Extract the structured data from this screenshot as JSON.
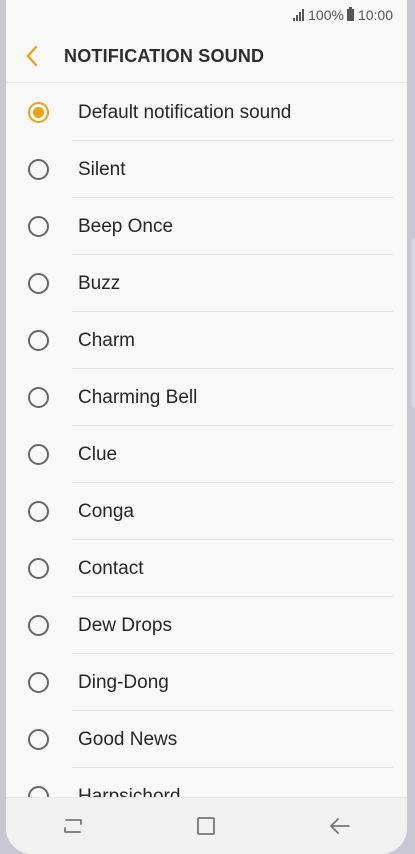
{
  "status_bar": {
    "battery": "100%",
    "time": "10:00"
  },
  "header": {
    "title": "NOTIFICATION SOUND"
  },
  "sounds": [
    {
      "label": "Default notification sound",
      "selected": true
    },
    {
      "label": "Silent",
      "selected": false
    },
    {
      "label": "Beep Once",
      "selected": false
    },
    {
      "label": "Buzz",
      "selected": false
    },
    {
      "label": "Charm",
      "selected": false
    },
    {
      "label": "Charming Bell",
      "selected": false
    },
    {
      "label": "Clue",
      "selected": false
    },
    {
      "label": "Conga",
      "selected": false
    },
    {
      "label": "Contact",
      "selected": false
    },
    {
      "label": "Dew Drops",
      "selected": false
    },
    {
      "label": "Ding-Dong",
      "selected": false
    },
    {
      "label": "Good News",
      "selected": false
    },
    {
      "label": "Harpsichord",
      "selected": false
    }
  ],
  "colors": {
    "accent": "#e8a317"
  },
  "icons": {
    "back": "back-arrow-icon",
    "recents": "recents-icon",
    "home": "home-icon",
    "nav_back": "nav-back-icon"
  }
}
